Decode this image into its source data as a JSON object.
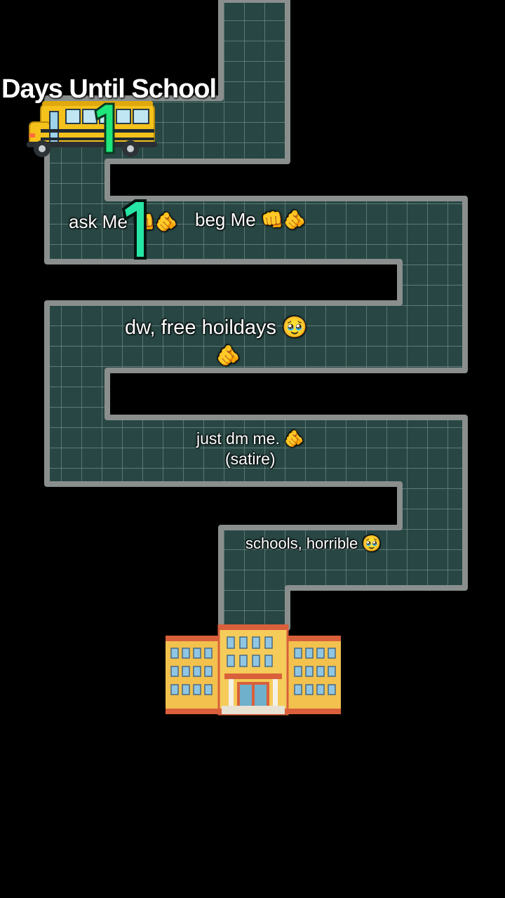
{
  "title": "Days Until School",
  "counter": "1",
  "messages": {
    "ask": "ask Me 👊🫵",
    "beg": "beg Me 👊🫵",
    "free_holidays": "dw, free hoildays 🥹",
    "point": "🫵",
    "dm": "just dm me. 🫵",
    "satire": "(satire)",
    "schools": "schools, horrible 🥹"
  },
  "icons": {
    "bus": "school-bus-icon",
    "school": "school-building-icon"
  },
  "colors": {
    "background": "#000000",
    "path_fill": "#284744",
    "path_border": "#8a8f8e",
    "grid_line": "#6f8985",
    "counter_green": "#22e07e",
    "bus_yellow": "#f5c21b",
    "school_wall": "#f2c14e",
    "school_roof": "#d9603b"
  }
}
